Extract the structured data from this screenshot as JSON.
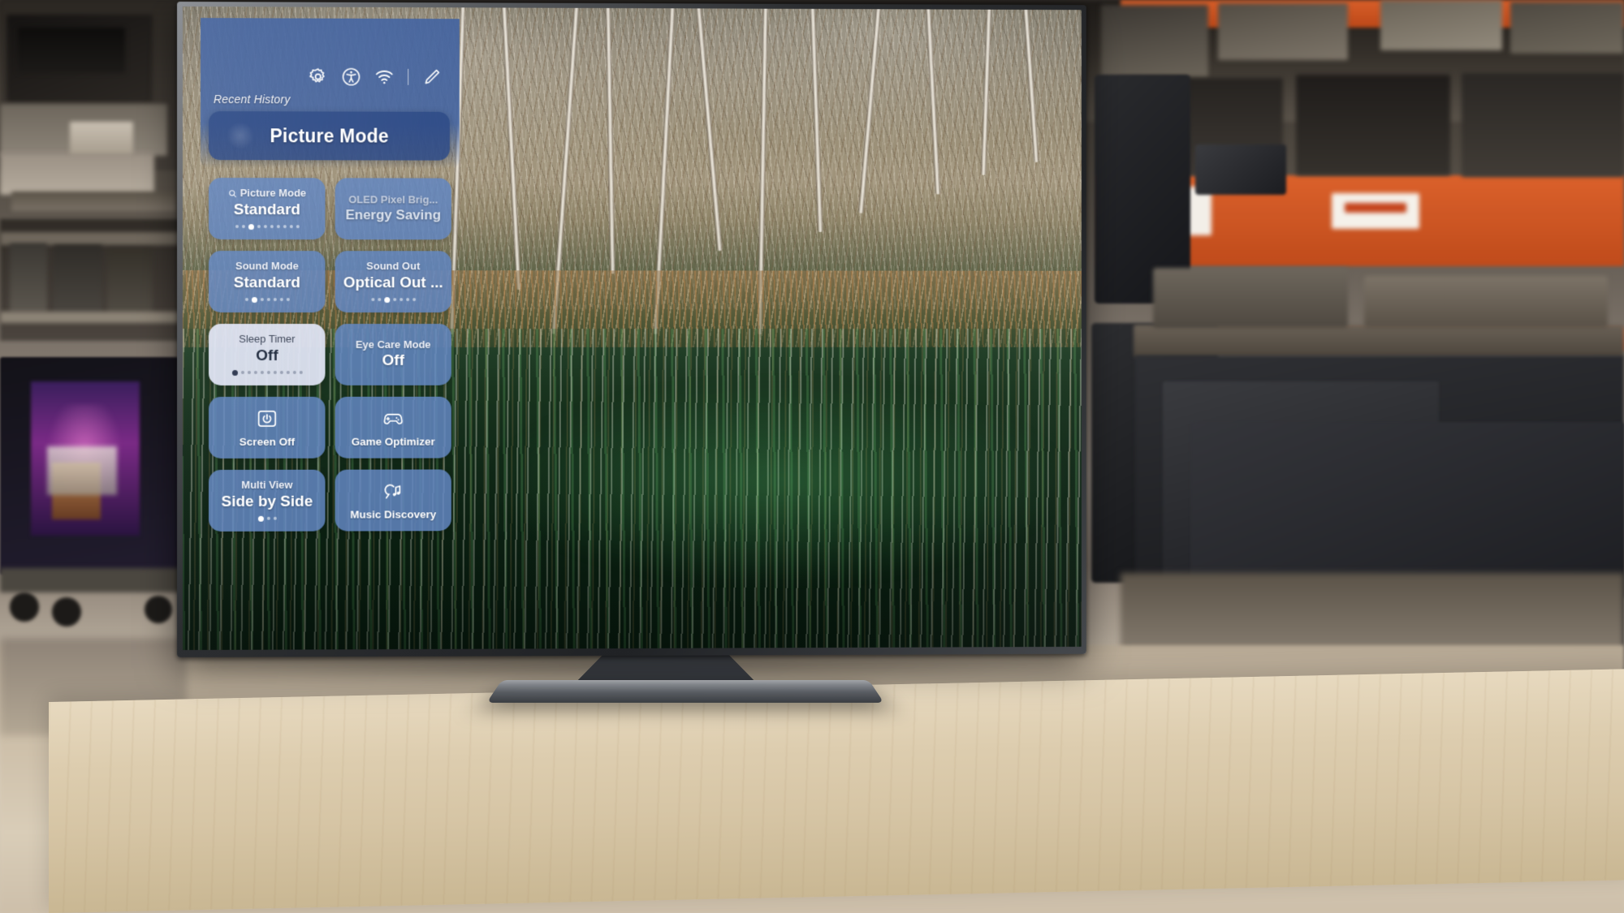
{
  "scene": {
    "description": "LG OLED TV on a wooden table in a warehouse showroom, displaying the Quick Settings overlay on top of a forest-and-river nature image",
    "device": "LG OLED TV"
  },
  "panel": {
    "title_icons": [
      {
        "name": "gear-icon",
        "label": "All Settings"
      },
      {
        "name": "accessibility-icon",
        "label": "Accessibility"
      },
      {
        "name": "wifi-icon",
        "label": "Network"
      },
      {
        "name": "divider",
        "label": ""
      },
      {
        "name": "edit-pencil-icon",
        "label": "Edit"
      }
    ],
    "recent_history_label": "Recent History",
    "recent_history_item": "Picture Mode",
    "tiles": [
      {
        "name": "picture-mode",
        "title": "Picture Mode",
        "value": "Standard",
        "has_search_icon": true,
        "dots_total": 10,
        "dots_active": 3,
        "state": "normal",
        "kind": "value"
      },
      {
        "name": "oled-pixel-brightness",
        "title": "OLED Pixel Brig...",
        "value": "Energy Saving",
        "has_search_icon": false,
        "dots_total": 0,
        "dots_active": 0,
        "state": "ghost",
        "kind": "value"
      },
      {
        "name": "sound-mode",
        "title": "Sound Mode",
        "value": "Standard",
        "has_search_icon": false,
        "dots_total": 7,
        "dots_active": 2,
        "state": "normal",
        "kind": "value"
      },
      {
        "name": "sound-out",
        "title": "Sound Out",
        "value": "Optical Out ...",
        "has_search_icon": false,
        "dots_total": 7,
        "dots_active": 3,
        "state": "normal",
        "kind": "value"
      },
      {
        "name": "sleep-timer",
        "title": "Sleep Timer",
        "value": "Off",
        "has_search_icon": false,
        "dots_total": 11,
        "dots_active": 1,
        "state": "focused",
        "kind": "value"
      },
      {
        "name": "eye-care-mode",
        "title": "Eye Care Mode",
        "value": "Off",
        "has_search_icon": false,
        "dots_total": 0,
        "dots_active": 0,
        "state": "normal",
        "kind": "value"
      },
      {
        "name": "screen-off",
        "title": "",
        "value": "",
        "label": "Screen Off",
        "icon": "power-icon",
        "state": "normal",
        "kind": "icon"
      },
      {
        "name": "game-optimizer",
        "title": "",
        "value": "",
        "label": "Game Optimizer",
        "icon": "gamepad-icon",
        "state": "normal",
        "kind": "icon"
      },
      {
        "name": "multi-view",
        "title": "Multi View",
        "value": "Side by Side",
        "has_search_icon": false,
        "dots_total": 3,
        "dots_active": 1,
        "state": "normal",
        "kind": "value"
      },
      {
        "name": "music-discovery",
        "title": "",
        "value": "",
        "label": "Music Discovery",
        "icon": "music-search-icon",
        "state": "normal",
        "kind": "icon"
      }
    ]
  },
  "colors": {
    "panel_blue": "#4464a0",
    "tile_blue": "#6286c0",
    "recent_card_blue": "#2f4b86",
    "focus_bg": "#dee3f2",
    "focus_text": "#1f2a3d",
    "text_white": "#ffffff"
  }
}
